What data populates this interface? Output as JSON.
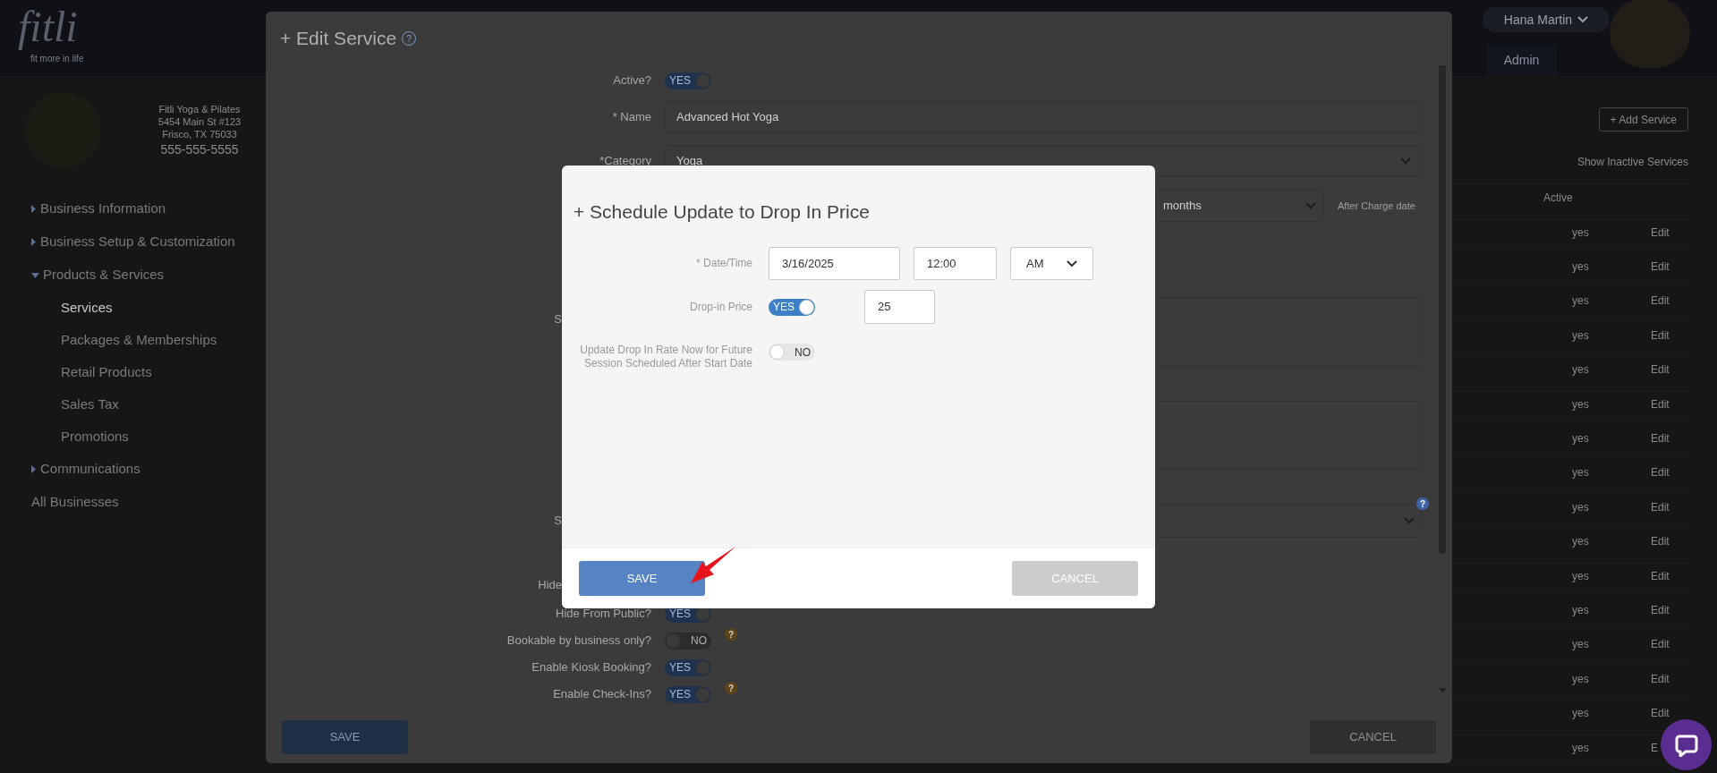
{
  "header": {
    "logo": "fitli",
    "tagline": "fit more in life",
    "user_menu": "Hana Martin",
    "tab": "Admin"
  },
  "sidebar": {
    "business": {
      "name": "Fitli Yoga & Pilates",
      "address": "5454 Main St #123",
      "city": "Frisco, TX 75033",
      "phone": "555-555-5555"
    },
    "nav": [
      {
        "kind": "group",
        "label": "Business Information",
        "expanded": false
      },
      {
        "kind": "group",
        "label": "Business Setup & Customization",
        "expanded": false
      },
      {
        "kind": "group",
        "label": "Products & Services",
        "expanded": true,
        "children": [
          {
            "label": "Services",
            "selected": true
          },
          {
            "label": "Packages & Memberships",
            "selected": false
          },
          {
            "label": "Retail Products",
            "selected": false
          },
          {
            "label": "Sales Tax",
            "selected": false
          },
          {
            "label": "Promotions",
            "selected": false
          }
        ]
      },
      {
        "kind": "group",
        "label": "Communications",
        "expanded": false
      },
      {
        "kind": "link",
        "label": "All Businesses"
      }
    ]
  },
  "services_page": {
    "add_button": "+ Add Service",
    "show_inactive": "Show Inactive Services",
    "active_header": "Active",
    "rows": [
      {
        "active": "yes",
        "action": "Edit"
      },
      {
        "active": "yes",
        "action": "Edit"
      },
      {
        "active": "yes",
        "action": "Edit"
      },
      {
        "active": "yes",
        "action": "Edit"
      },
      {
        "active": "yes",
        "action": "Edit"
      },
      {
        "active": "yes",
        "action": "Edit"
      },
      {
        "active": "yes",
        "action": "Edit"
      },
      {
        "active": "yes",
        "action": "Edit"
      },
      {
        "active": "yes",
        "action": "Edit"
      },
      {
        "active": "yes",
        "action": "Edit"
      },
      {
        "active": "yes",
        "action": "Edit"
      },
      {
        "active": "yes",
        "action": "Edit"
      },
      {
        "active": "yes",
        "action": "Edit"
      },
      {
        "active": "yes",
        "action": "Edit"
      },
      {
        "active": "yes",
        "action": "Edit"
      },
      {
        "active": "yes",
        "action": "E"
      }
    ]
  },
  "edit_service": {
    "title": "+ Edit Service",
    "help_glyph": "?",
    "active": {
      "label": "Active?",
      "on": true,
      "text": "YES"
    },
    "name": {
      "label": "* Name",
      "value": "Advanced Hot Yoga"
    },
    "category": {
      "label": "*Category",
      "value": "Yoga"
    },
    "period": {
      "value": "months",
      "note": "After Charge date"
    },
    "partial_labels": [
      "S",
      "S",
      "Hide"
    ],
    "select_help": "?",
    "toggles": [
      {
        "label": "Hide From Public?",
        "on": true,
        "text": "YES"
      },
      {
        "label": "Bookable by business only?",
        "on": false,
        "text": "NO",
        "help": "?"
      },
      {
        "label": "Enable Kiosk Booking?",
        "on": true,
        "text": "YES"
      },
      {
        "label": "Enable Check-Ins?",
        "on": true,
        "text": "YES",
        "help": "?"
      }
    ],
    "save": "SAVE",
    "cancel": "CANCEL"
  },
  "schedule_modal": {
    "title": "+ Schedule Update to Drop In Price",
    "date_label": "* Date/Time",
    "date": "3/16/2025",
    "time": "12:00",
    "meridiem": "AM",
    "price_label": "Drop-in Price",
    "price_toggle": {
      "on": true,
      "text": "YES"
    },
    "price": "25",
    "update_label": "Update Drop In Rate Now for Future Session Scheduled After Start Date",
    "update_toggle": {
      "on": false,
      "text": "NO"
    },
    "save": "SAVE",
    "cancel": "CANCEL"
  }
}
